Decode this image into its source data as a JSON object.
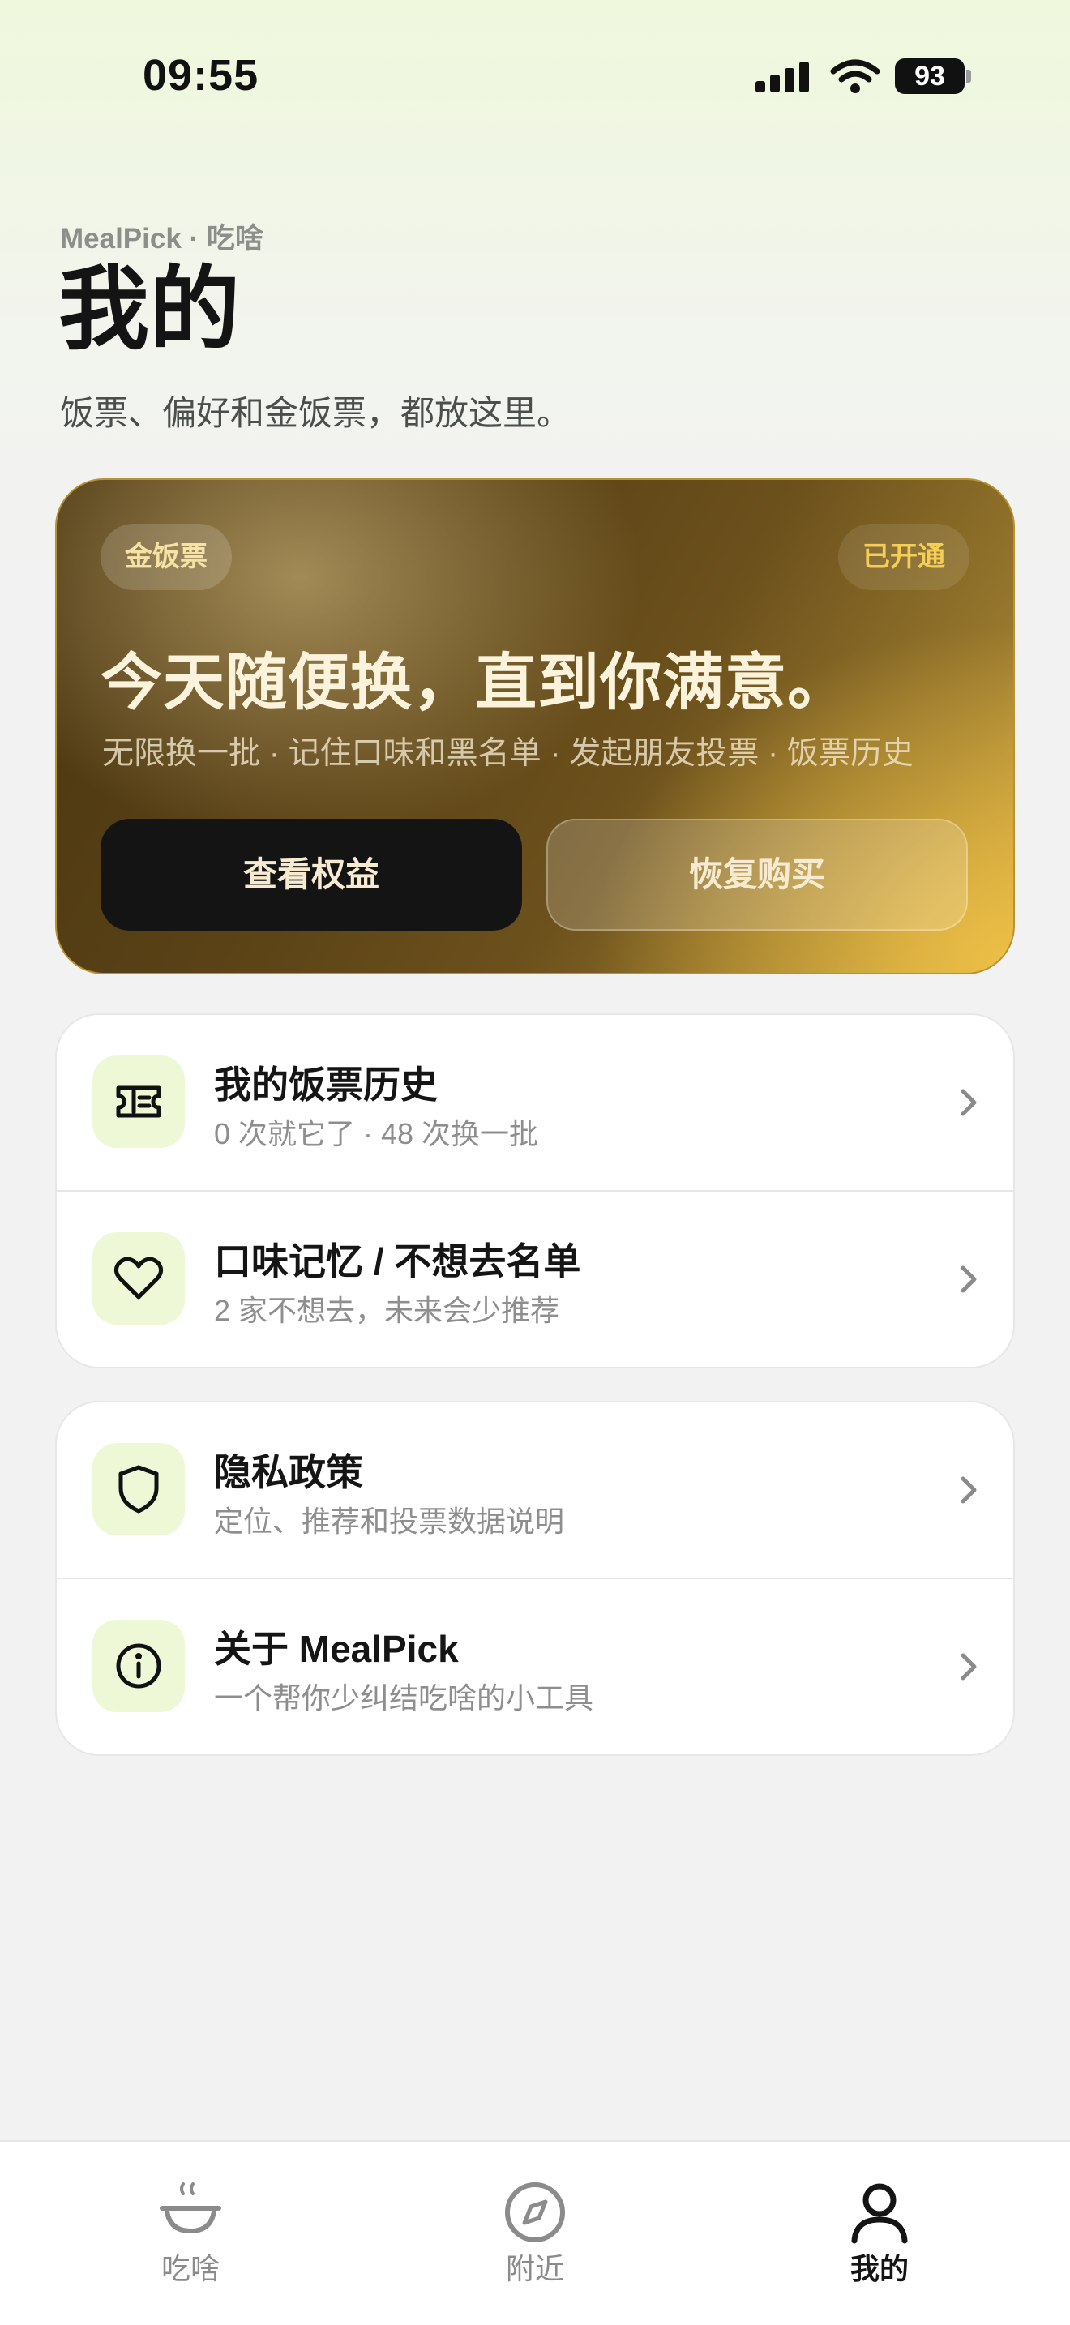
{
  "status_bar": {
    "time": "09:55",
    "battery": "93"
  },
  "header": {
    "eyebrow": "MealPick · 吃啥",
    "title": "我的",
    "subtitle": "饭票、偏好和金饭票，都放这里。"
  },
  "gold_card": {
    "badge": "金饭票",
    "status": "已开通",
    "headline": "今天随便换，直到你满意。",
    "features": "无限换一批 · 记住口味和黑名单 · 发起朋友投票 · 饭票历史",
    "primary_button": "查看权益",
    "secondary_button": "恢复购买",
    "colors": {
      "badge_text": "#f6e2a3",
      "status_text": "#f5cf55",
      "accent": "#e8bd45"
    }
  },
  "list_group_1": [
    {
      "icon": "ticket-icon",
      "title": "我的饭票历史",
      "subtitle": "0 次就它了 · 48 次换一批"
    },
    {
      "icon": "heart-icon",
      "title": "口味记忆 / 不想去名单",
      "subtitle": "2 家不想去，未来会少推荐"
    }
  ],
  "list_group_2": [
    {
      "icon": "shield-icon",
      "title": "隐私政策",
      "subtitle": "定位、推荐和投票数据说明"
    },
    {
      "icon": "info-icon",
      "title": "关于 MealPick",
      "subtitle": "一个帮你少纠结吃啥的小工具"
    }
  ],
  "tab_bar": {
    "active": "我的",
    "tabs": [
      {
        "icon": "bowl-icon",
        "label": "吃啥"
      },
      {
        "icon": "compass-icon",
        "label": "附近"
      },
      {
        "icon": "person-icon",
        "label": "我的"
      }
    ]
  }
}
